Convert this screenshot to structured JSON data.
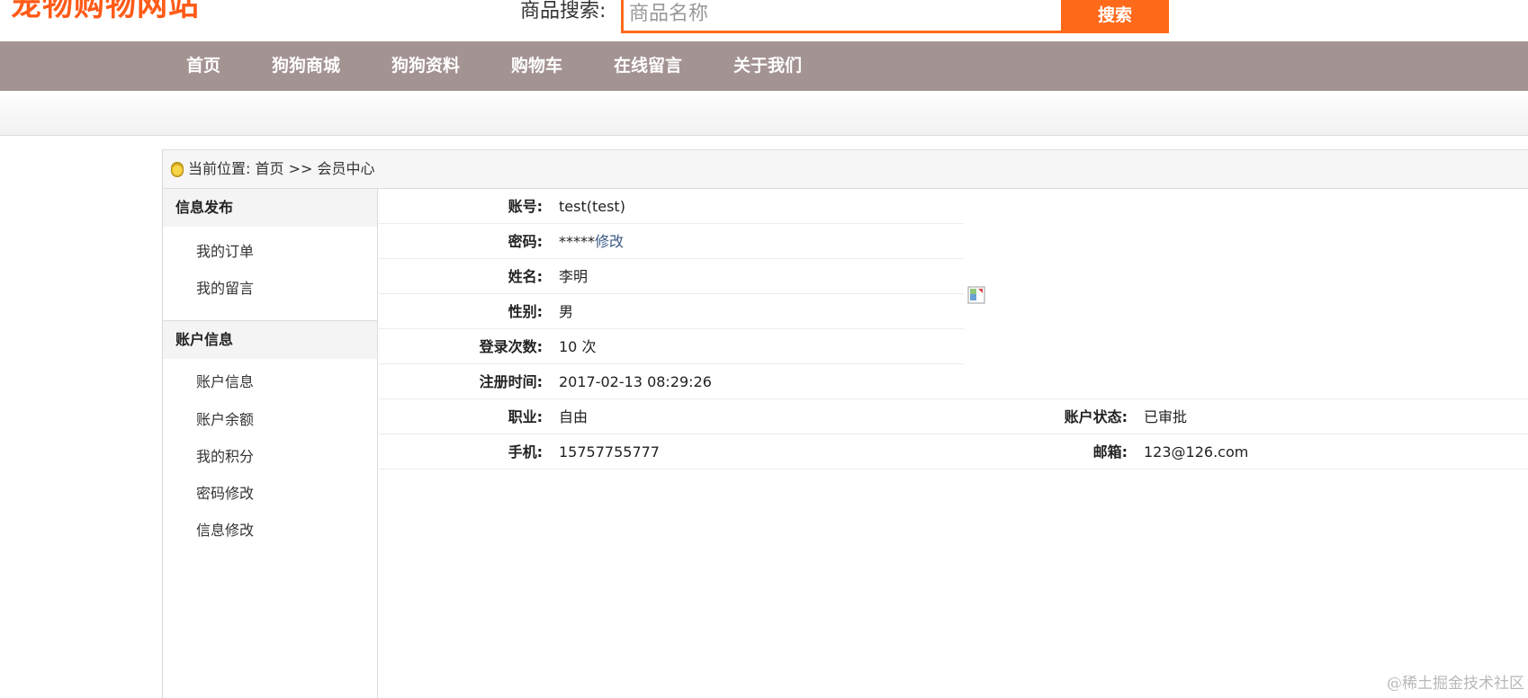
{
  "header": {
    "logo_text": "宠物购物网站",
    "search_label": "商品搜索:",
    "search_placeholder": "商品名称",
    "search_button": "搜索"
  },
  "nav": {
    "items": [
      "首页",
      "狗狗商城",
      "狗狗资料",
      "购物车",
      "在线留言",
      "关于我们"
    ]
  },
  "breadcrumb": {
    "prefix": "当前位置:",
    "home": "首页",
    "separator": ">>",
    "current": "会员中心"
  },
  "sidebar": {
    "groups": [
      {
        "title": "信息发布",
        "links": [
          "我的订单",
          "我的留言"
        ]
      },
      {
        "title": "账户信息",
        "links": [
          "账户信息",
          "账户余额",
          "我的积分",
          "密码修改",
          "信息修改"
        ]
      }
    ]
  },
  "profile": {
    "account_label": "账号:",
    "account": "test(test)",
    "password_label": "密码:",
    "password": "*****",
    "password_edit": "修改",
    "name_label": "姓名:",
    "name": "李明",
    "gender_label": "性别:",
    "gender": "男",
    "login_count_label": "登录次数:",
    "login_count": "10 次",
    "register_time_label": "注册时间:",
    "register_time": "2017-02-13 08:29:26",
    "job_label": "职业:",
    "job": "自由",
    "status_label": "账户状态:",
    "status": "已审批",
    "phone_label": "手机:",
    "phone": "15757755777",
    "email_label": "邮箱:",
    "email": "123@126.com"
  },
  "watermark": "@稀土掘金技术社区",
  "colors": {
    "brand_orange": "#ff6a1a",
    "nav_background": "#a39392",
    "link_blue": "#3b5a86"
  }
}
